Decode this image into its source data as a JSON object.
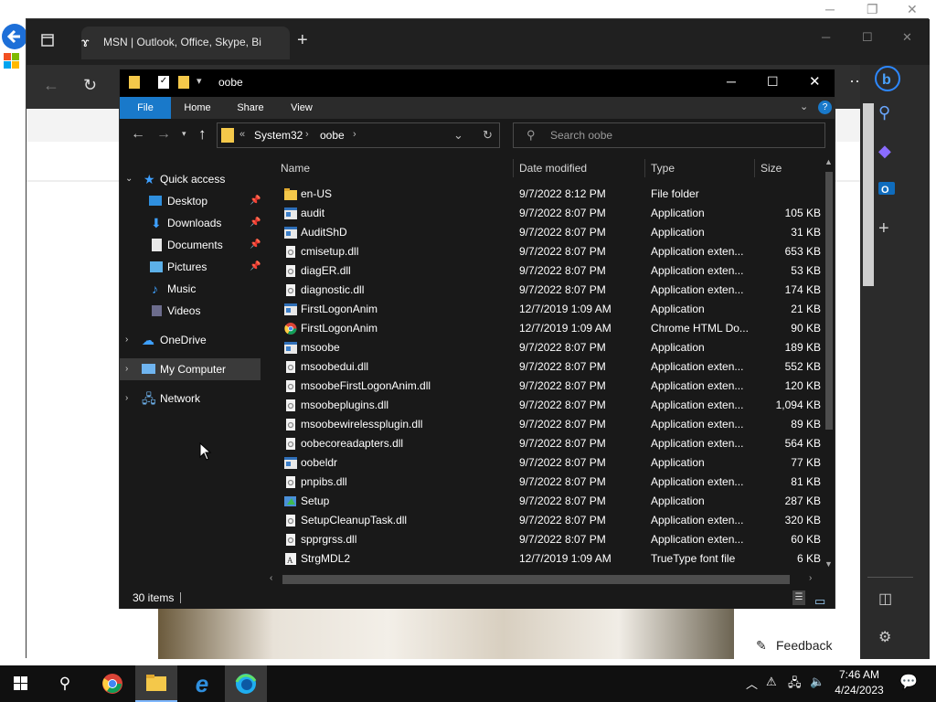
{
  "browser": {
    "tab_title": "MSN | Outlook, Office, Skype, Bi",
    "feedback_label": "Feedback"
  },
  "explorer": {
    "title": "oobe",
    "ribbon_tabs": [
      "File",
      "Home",
      "Share",
      "View"
    ],
    "address": {
      "prefix": "«",
      "crumb1": "System32",
      "crumb2": "oobe"
    },
    "search_placeholder": "Search oobe",
    "nav": {
      "quick_access": "Quick access",
      "desktop": "Desktop",
      "downloads": "Downloads",
      "documents": "Documents",
      "pictures": "Pictures",
      "music": "Music",
      "videos": "Videos",
      "onedrive": "OneDrive",
      "my_computer": "My Computer",
      "network": "Network"
    },
    "columns": {
      "name": "Name",
      "date": "Date modified",
      "type": "Type",
      "size": "Size"
    },
    "files": [
      {
        "name": "en-US",
        "date": "9/7/2022 8:12 PM",
        "type": "File folder",
        "size": "",
        "icon": "folder"
      },
      {
        "name": "audit",
        "date": "9/7/2022 8:07 PM",
        "type": "Application",
        "size": "105 KB",
        "icon": "app"
      },
      {
        "name": "AuditShD",
        "date": "9/7/2022 8:07 PM",
        "type": "Application",
        "size": "31 KB",
        "icon": "app"
      },
      {
        "name": "cmisetup.dll",
        "date": "9/7/2022 8:07 PM",
        "type": "Application exten...",
        "size": "653 KB",
        "icon": "dll"
      },
      {
        "name": "diagER.dll",
        "date": "9/7/2022 8:07 PM",
        "type": "Application exten...",
        "size": "53 KB",
        "icon": "dll"
      },
      {
        "name": "diagnostic.dll",
        "date": "9/7/2022 8:07 PM",
        "type": "Application exten...",
        "size": "174 KB",
        "icon": "dll"
      },
      {
        "name": "FirstLogonAnim",
        "date": "12/7/2019 1:09 AM",
        "type": "Application",
        "size": "21 KB",
        "icon": "app"
      },
      {
        "name": "FirstLogonAnim",
        "date": "12/7/2019 1:09 AM",
        "type": "Chrome HTML Do...",
        "size": "90 KB",
        "icon": "chrome"
      },
      {
        "name": "msoobe",
        "date": "9/7/2022 8:07 PM",
        "type": "Application",
        "size": "189 KB",
        "icon": "app"
      },
      {
        "name": "msoobedui.dll",
        "date": "9/7/2022 8:07 PM",
        "type": "Application exten...",
        "size": "552 KB",
        "icon": "dll"
      },
      {
        "name": "msoobeFirstLogonAnim.dll",
        "date": "9/7/2022 8:07 PM",
        "type": "Application exten...",
        "size": "120 KB",
        "icon": "dll"
      },
      {
        "name": "msoobeplugins.dll",
        "date": "9/7/2022 8:07 PM",
        "type": "Application exten...",
        "size": "1,094 KB",
        "icon": "dll"
      },
      {
        "name": "msoobewirelessplugin.dll",
        "date": "9/7/2022 8:07 PM",
        "type": "Application exten...",
        "size": "89 KB",
        "icon": "dll"
      },
      {
        "name": "oobecoreadapters.dll",
        "date": "9/7/2022 8:07 PM",
        "type": "Application exten...",
        "size": "564 KB",
        "icon": "dll"
      },
      {
        "name": "oobeldr",
        "date": "9/7/2022 8:07 PM",
        "type": "Application",
        "size": "77 KB",
        "icon": "app"
      },
      {
        "name": "pnpibs.dll",
        "date": "9/7/2022 8:07 PM",
        "type": "Application exten...",
        "size": "81 KB",
        "icon": "dll"
      },
      {
        "name": "Setup",
        "date": "9/7/2022 8:07 PM",
        "type": "Application",
        "size": "287 KB",
        "icon": "setup"
      },
      {
        "name": "SetupCleanupTask.dll",
        "date": "9/7/2022 8:07 PM",
        "type": "Application exten...",
        "size": "320 KB",
        "icon": "dll"
      },
      {
        "name": "spprgrss.dll",
        "date": "9/7/2022 8:07 PM",
        "type": "Application exten...",
        "size": "60 KB",
        "icon": "dll"
      },
      {
        "name": "StrgMDL2",
        "date": "12/7/2019 1:09 AM",
        "type": "TrueType font file",
        "size": "6 KB",
        "icon": "font"
      }
    ],
    "status": "30 items"
  },
  "taskbar": {
    "time": "7:46 AM",
    "date": "4/24/2023"
  },
  "colors": {
    "accent": "#1979ca",
    "folder": "#f4c84a",
    "dark_bg": "#191919"
  }
}
